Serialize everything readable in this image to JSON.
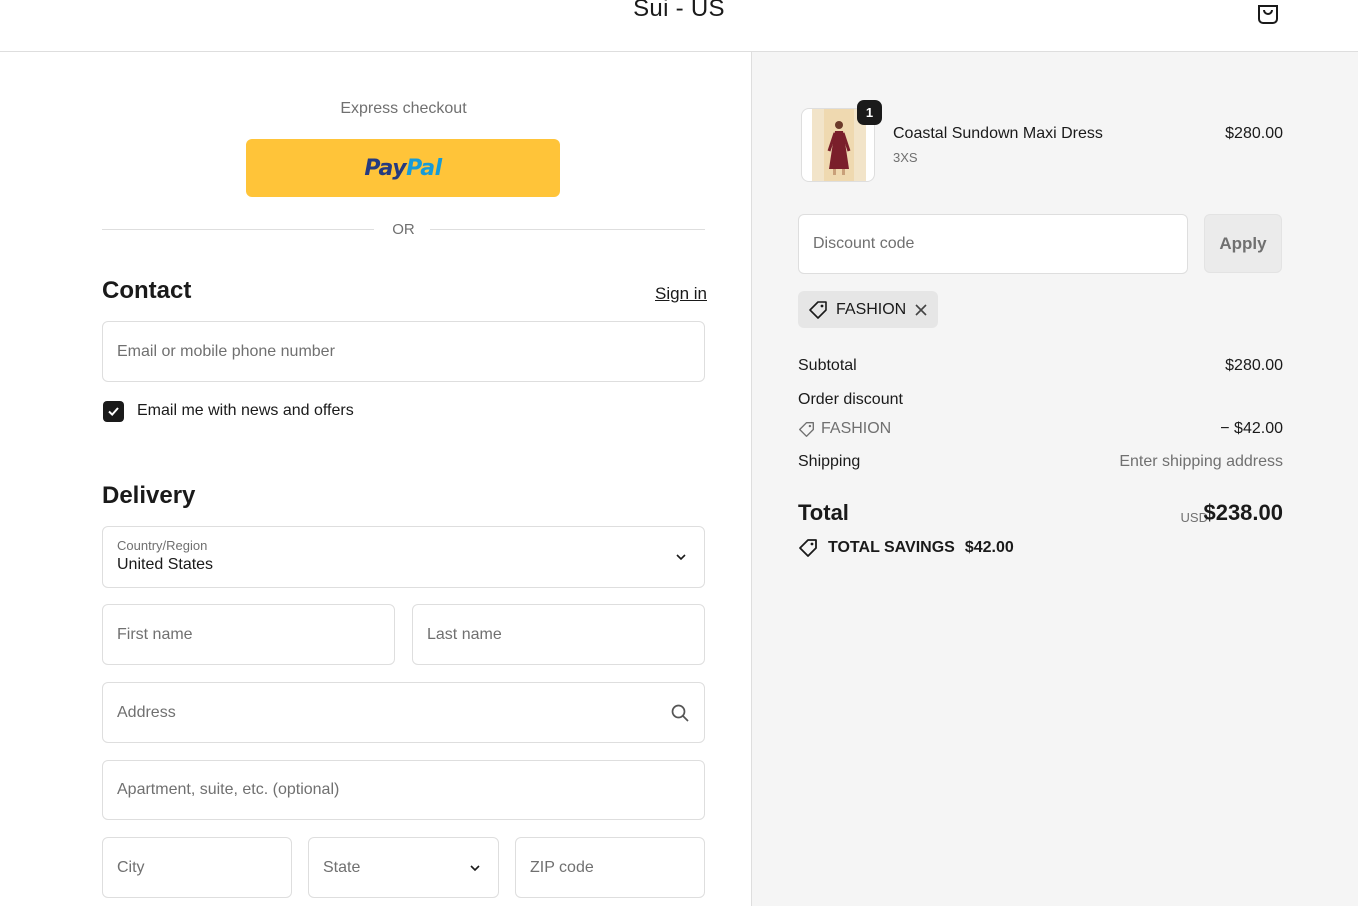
{
  "header": {
    "shop_name": "Sui - US",
    "cart_icon": "shopping-bag-icon"
  },
  "express": {
    "title": "Express checkout",
    "paypal_part1": "Pay",
    "paypal_part2": "Pal",
    "or_text": "OR"
  },
  "contact": {
    "title": "Contact",
    "signin_label": "Sign in",
    "email_placeholder": "Email or mobile phone number",
    "newsletter_label": "Email me with news and offers",
    "newsletter_checked": true
  },
  "delivery": {
    "title": "Delivery",
    "country_label": "Country/Region",
    "country_value": "United States",
    "first_name_placeholder": "First name",
    "last_name_placeholder": "Last name",
    "address_placeholder": "Address",
    "apartment_placeholder": "Apartment, suite, etc. (optional)",
    "city_placeholder": "City",
    "state_placeholder": "State",
    "zip_placeholder": "ZIP code"
  },
  "cart": {
    "item": {
      "quantity": "1",
      "name": "Coastal Sundown Maxi Dress",
      "variant": "3XS",
      "price": "$280.00"
    },
    "discount_placeholder": "Discount code",
    "apply_label": "Apply",
    "applied_code": "FASHION"
  },
  "summary": {
    "subtotal_label": "Subtotal",
    "subtotal_value": "$280.00",
    "order_discount_label": "Order discount",
    "discount_code": "FASHION",
    "discount_value": "− $42.00",
    "shipping_label": "Shipping",
    "shipping_value": "Enter shipping address",
    "total_label": "Total",
    "total_currency": "USD",
    "total_value": "$238.00",
    "savings_label": "TOTAL SAVINGS",
    "savings_value": "$42.00"
  },
  "colors": {
    "paypal_yellow": "#ffc439",
    "text": "#1a1a1a",
    "muted": "#707070",
    "border": "#dedede",
    "summary_bg": "#f5f5f5"
  }
}
